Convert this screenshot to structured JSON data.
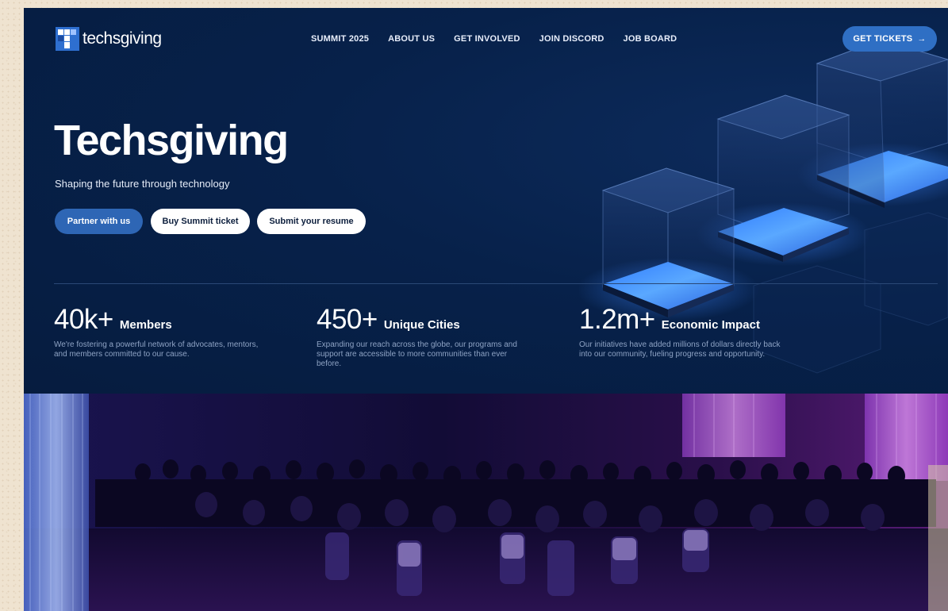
{
  "brand": {
    "name_part1": "techs",
    "name_part2": "giving"
  },
  "nav": {
    "items": [
      "SUMMIT 2025",
      "ABOUT US",
      "GET INVOLVED",
      "JOIN DISCORD",
      "JOB BOARD"
    ],
    "cta_label": "GET TICKETS",
    "cta_arrow": "→"
  },
  "hero": {
    "title": "Techsgiving",
    "subtitle": "Shaping the future through technology",
    "buttons": {
      "partner": "Partner with us",
      "buy_ticket": "Buy Summit ticket",
      "resume": "Submit your resume"
    }
  },
  "stats": [
    {
      "number": "40k+",
      "label": "Members",
      "description": "We're fostering a powerful network of advocates, mentors, and members committed to our cause."
    },
    {
      "number": "450+",
      "label": "Unique Cities",
      "description": "Expanding our reach across the globe, our programs and support are accessible to more communities than ever before."
    },
    {
      "number": "1.2m+",
      "label": "Economic Impact",
      "description": "Our initiatives have added millions of dollars directly back into our community, fueling progress and opportunity."
    }
  ],
  "colors": {
    "hero_bg": "#061c3f",
    "accent_blue": "#2f6fc4",
    "glow_blue": "#3d8bff",
    "white": "#ffffff"
  },
  "icons": {
    "logo": "techsgiving-logo-mark",
    "cta": "arrow-right-icon"
  }
}
